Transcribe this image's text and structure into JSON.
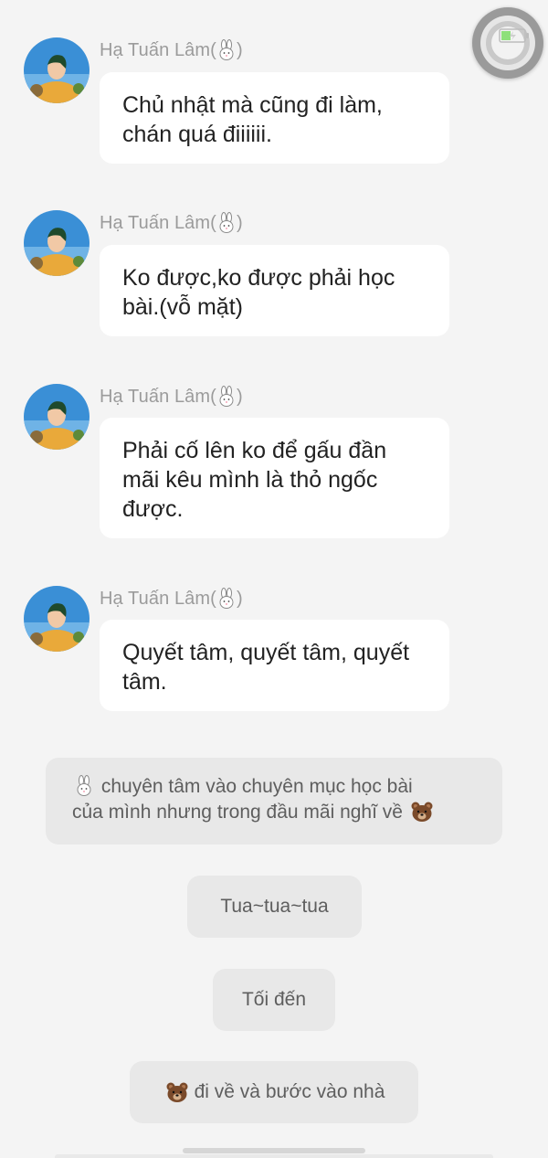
{
  "messages": [
    {
      "sender": "Hạ Tuấn Lâm(",
      "sender_close": ")",
      "sender_icon": "rabbit-icon",
      "lines": [
        "Chủ nhật mà cũng đi làm,",
        "chán quá điiiiii."
      ]
    },
    {
      "sender": "Hạ Tuấn Lâm(",
      "sender_close": ")",
      "sender_icon": "rabbit-icon",
      "lines": [
        "Ko được,ko được phải học",
        "bài.(vỗ mặt)"
      ]
    },
    {
      "sender": "Hạ Tuấn Lâm(",
      "sender_close": ")",
      "sender_icon": "rabbit-icon",
      "lines": [
        "Phải cố lên ko để gấu đần",
        "mãi kêu mình là thỏ ngốc",
        "được."
      ]
    },
    {
      "sender": "Hạ Tuấn Lâm(",
      "sender_close": ")",
      "sender_icon": "rabbit-icon",
      "lines": [
        "Quyết tâm, quyết tâm, quyết",
        "tâm."
      ]
    }
  ],
  "narration": {
    "first": {
      "line1": "chuyên tâm vào chuyên mục học bài",
      "line2": "của mình nhưng trong đầu mãi nghĩ về",
      "icons": [
        "rabbit-icon",
        "bear-icon"
      ]
    },
    "second": "Tua~tua~tua",
    "third": "Tối đến",
    "fourth": {
      "text": "đi về và bước vào nhà",
      "icon": "bear-icon"
    }
  },
  "colors": {
    "background": "#f4f4f4",
    "bubble": "#ffffff",
    "pill": "#e8e8e8",
    "sender": "#9b9b9b"
  }
}
